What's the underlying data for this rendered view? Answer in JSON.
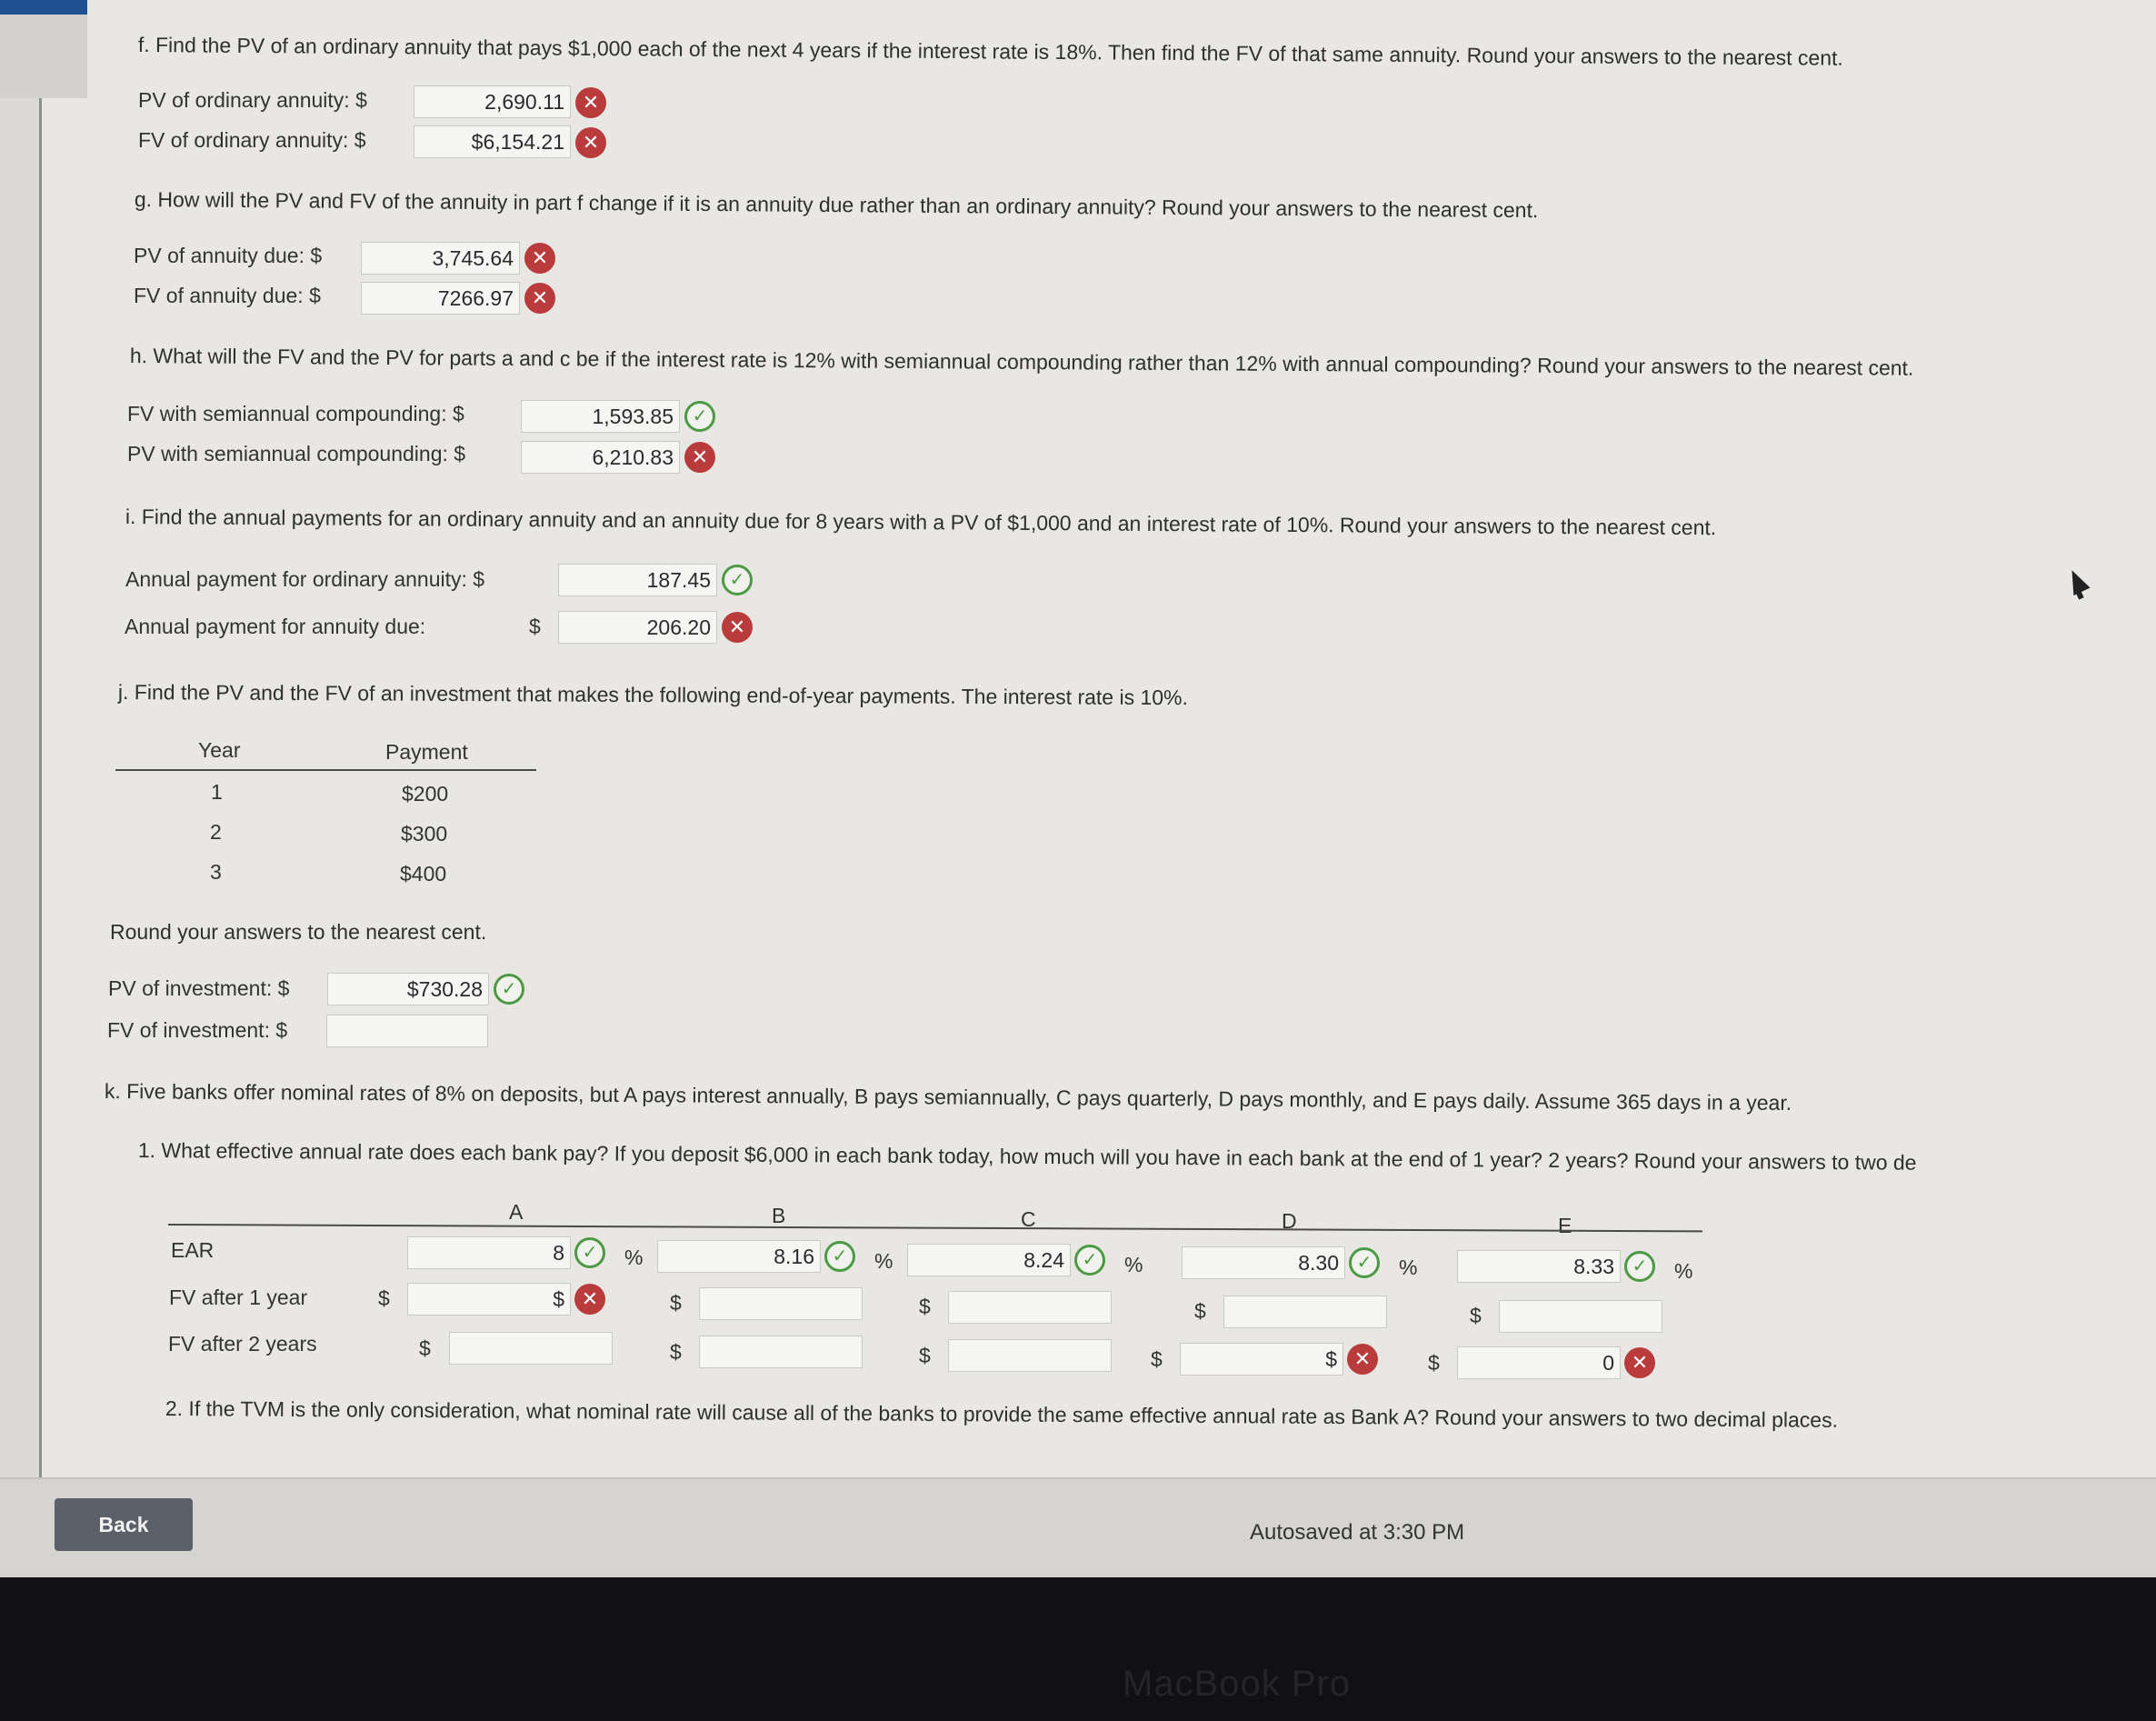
{
  "questions": {
    "f": {
      "prompt": "f. Find the PV of an ordinary annuity that pays $1,000 each of the next 4 years if the interest rate is 18%. Then find the FV of that same annuity. Round your answers to the nearest cent.",
      "rows": [
        {
          "label": "PV of ordinary annuity: $",
          "value": "2,690.11",
          "status": "incorrect"
        },
        {
          "label": "FV of ordinary annuity: $",
          "value": "$6,154.21",
          "status": "incorrect"
        }
      ]
    },
    "g": {
      "prompt": "g. How will the PV and FV of the annuity in part f change if it is an annuity due rather than an ordinary annuity? Round your answers to the nearest cent.",
      "rows": [
        {
          "label": "PV of annuity due: $",
          "value": "3,745.64",
          "status": "incorrect"
        },
        {
          "label": "FV of annuity due: $",
          "value": "7266.97",
          "status": "incorrect"
        }
      ]
    },
    "h": {
      "prompt": "h. What will the FV and the PV for parts a and c be if the interest rate is 12% with semiannual compounding rather than 12% with annual compounding? Round your answers to the nearest cent.",
      "rows": [
        {
          "label": "FV with semiannual compounding: $",
          "value": "1,593.85",
          "status": "correct"
        },
        {
          "label": "PV with semiannual compounding: $",
          "value": "6,210.83",
          "status": "incorrect"
        }
      ]
    },
    "i": {
      "prompt": "i. Find the annual payments for an ordinary annuity and an annuity due for 8 years with a PV of $1,000 and an interest rate of 10%. Round your answers to the nearest cent.",
      "rows": [
        {
          "label": "Annual payment for ordinary annuity: $",
          "value": "187.45",
          "status": "correct"
        },
        {
          "label": "Annual payment for annuity due:",
          "dollar": "$",
          "value": "206.20",
          "status": "incorrect"
        }
      ]
    },
    "j": {
      "prompt": "j. Find the PV and the FV of an investment that makes the following end-of-year payments. The interest rate is 10%.",
      "table": {
        "headers": [
          "Year",
          "Payment"
        ],
        "rows": [
          [
            "1",
            "$200"
          ],
          [
            "2",
            "$300"
          ],
          [
            "3",
            "$400"
          ]
        ]
      },
      "round_note": "Round your answers to the nearest cent.",
      "rows": [
        {
          "label": "PV of investment: $",
          "value": "$730.28",
          "status": "correct"
        },
        {
          "label": "FV of investment: $",
          "value": "",
          "status": "none"
        }
      ]
    },
    "k": {
      "prompt": "k. Five banks offer nominal rates of 8% on deposits, but A pays interest annually, B pays semiannually, C pays quarterly, D pays monthly, and E pays daily. Assume 365 days in a year.",
      "sub1": "1.  What effective annual rate does each bank pay? If you deposit $6,000 in each bank today, how much will you have in each bank at the end of 1 year? 2 years? Round your answers to two de",
      "columns": [
        "A",
        "B",
        "C",
        "D",
        "E"
      ],
      "row_labels": [
        "EAR",
        "FV after 1 year",
        "FV after 2 years"
      ],
      "currency": "$",
      "percent": "%",
      "ear": [
        "8",
        "8.16",
        "8.24",
        "8.30",
        "8.33"
      ],
      "fv1": [
        "$",
        "",
        "",
        "",
        ""
      ],
      "fv2": [
        "",
        "",
        "",
        "$",
        "0"
      ],
      "sub2": "2.  If the TVM is the only consideration, what nominal rate will cause all of the banks to provide the same effective annual rate as Bank A? Round your answers to two decimal places."
    }
  },
  "icons": {
    "correct": "✓",
    "incorrect": "✕"
  },
  "footer": {
    "back_label": "Back",
    "autosave": "Autosaved at 3:30 PM"
  },
  "device": {
    "brand": "MacBook Pro"
  }
}
